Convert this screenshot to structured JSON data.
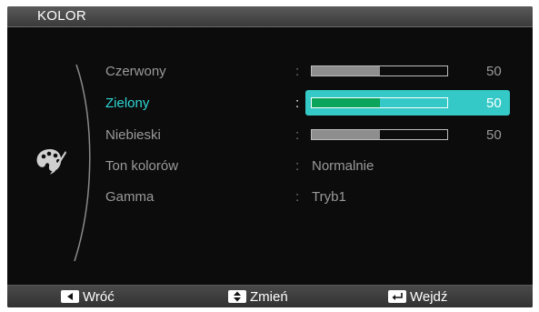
{
  "menu": {
    "title": "KOLOR"
  },
  "items": [
    {
      "label": "Czerwony",
      "value_percent": 50,
      "value": "50",
      "selected": false
    },
    {
      "label": "Zielony",
      "value_percent": 50,
      "value": "50",
      "selected": true
    },
    {
      "label": "Niebieski",
      "value_percent": 50,
      "value": "50",
      "selected": false
    },
    {
      "label": "Ton kolorów",
      "value_text": "Normalnie"
    },
    {
      "label": "Gamma",
      "value_text": "Tryb1"
    }
  ],
  "colon": ":",
  "bottom_bar": {
    "back": {
      "icon": "left-arrow-icon",
      "label": "Wróć"
    },
    "change": {
      "icon": "up-down-arrow-icon",
      "label": "Zmień"
    },
    "enter": {
      "icon": "enter-icon",
      "label": "Wejdź"
    }
  },
  "colors": {
    "highlight": "#34c9c7",
    "selected_label": "#2fd6d4",
    "green_fill": "#0aa45a",
    "gray_fill": "#8e8e8e"
  },
  "category_icon": "palette-icon"
}
